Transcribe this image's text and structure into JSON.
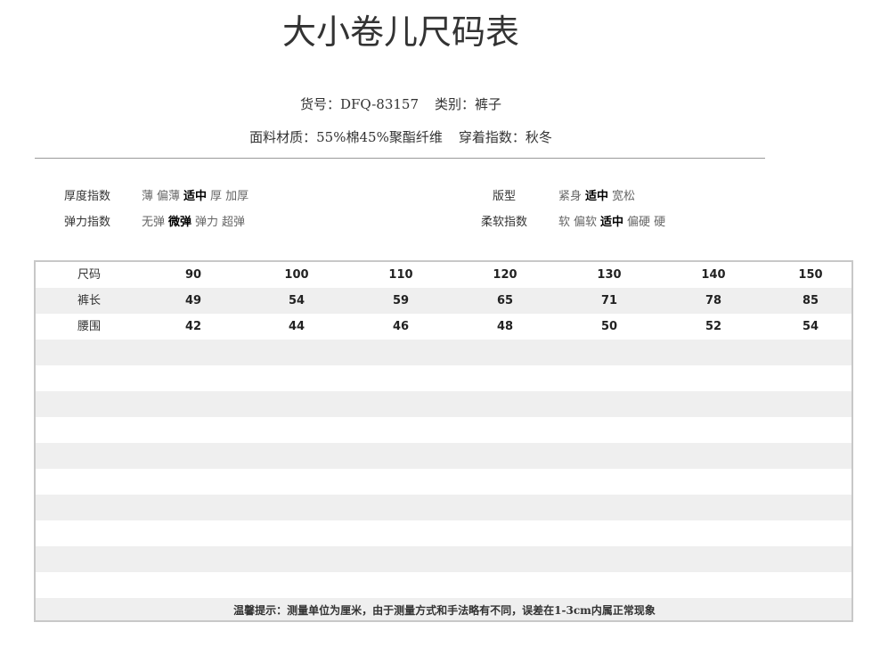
{
  "title": "大小卷儿尺码表",
  "meta": {
    "item_no_label": "货号：",
    "item_no": "DFQ-83157",
    "category_label": "类别：",
    "category": "裤子",
    "fabric_label": "面料材质：",
    "fabric": "55%棉45%聚酯纤维",
    "season_label": "穿着指数：",
    "season": "秋冬"
  },
  "attributes": {
    "thickness": {
      "label": "厚度指数",
      "options": [
        "薄",
        "偏薄",
        "适中",
        "厚",
        "加厚"
      ],
      "selected": "适中"
    },
    "fit": {
      "label": "版型",
      "options": [
        "紧身",
        "适中",
        "宽松"
      ],
      "selected": "适中"
    },
    "elasticity": {
      "label": "弹力指数",
      "options": [
        "无弹",
        "微弹",
        "弹力",
        "超弹"
      ],
      "selected": "微弹"
    },
    "softness": {
      "label": "柔软指数",
      "options": [
        "软",
        "偏软",
        "适中",
        "偏硬",
        "硬"
      ],
      "selected": "适中"
    }
  },
  "size_table": {
    "header_label": "尺码",
    "sizes": [
      "90",
      "100",
      "110",
      "120",
      "130",
      "140",
      "150"
    ],
    "rows": [
      {
        "label": "裤长",
        "values": [
          "49",
          "54",
          "59",
          "65",
          "71",
          "78",
          "85"
        ]
      },
      {
        "label": "腰围",
        "values": [
          "42",
          "44",
          "46",
          "48",
          "50",
          "52",
          "54"
        ]
      }
    ]
  },
  "footer_note": "温馨提示：测量单位为厘米，由于测量方式和手法略有不同，误差在1-3cm内属正常现象"
}
